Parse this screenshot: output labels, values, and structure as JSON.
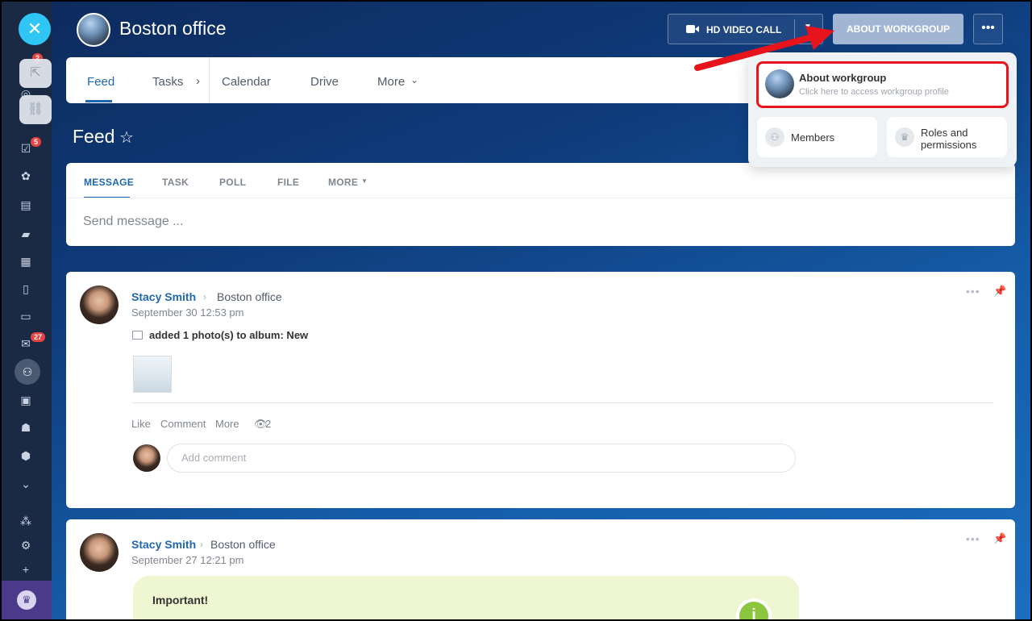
{
  "header": {
    "group_name": "Boston office",
    "video_call_label": "HD VIDEO CALL",
    "about_label": "ABOUT WORKGROUP",
    "more_icon": "more-dots-icon"
  },
  "sidebar": {
    "badges": {
      "top": "2",
      "tasks": "5",
      "mail": "27"
    }
  },
  "tabs": {
    "items": [
      "Feed",
      "Tasks",
      "Calendar",
      "Drive",
      "More"
    ],
    "active": "Feed"
  },
  "feed": {
    "title": "Feed",
    "composer_tabs": [
      "MESSAGE",
      "TASK",
      "POLL",
      "FILE",
      "MORE"
    ],
    "composer_placeholder": "Send message ..."
  },
  "posts": [
    {
      "author": "Stacy Smith",
      "target": "Boston office",
      "date": "September 30 12:53 pm",
      "action": "added 1 photo(s) to album: New",
      "actions": {
        "like": "Like",
        "comment": "Comment",
        "more": "More",
        "views": "2"
      },
      "comment_placeholder": "Add comment"
    },
    {
      "author": "Stacy Smith",
      "target": "Boston office",
      "date": "September 27 12:21 pm",
      "important_label": "Important!"
    }
  ],
  "popup": {
    "about_title": "About workgroup",
    "about_sub": "Click here to access workgroup profile",
    "members_label": "Members",
    "roles_label_line1": "Roles and",
    "roles_label_line2": "permissions"
  },
  "colors": {
    "accent": "#1f67b0",
    "highlight": "#e8141c",
    "sidebar_close": "#2fc6f6"
  }
}
